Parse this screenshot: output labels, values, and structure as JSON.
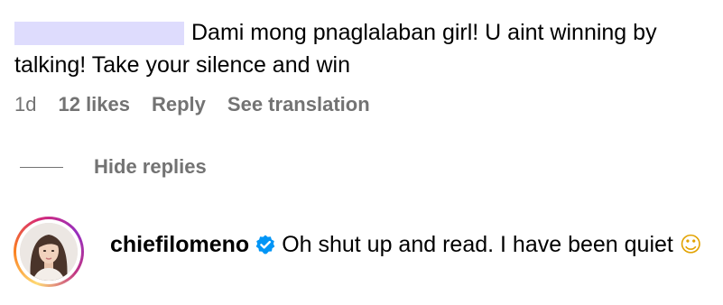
{
  "top_comment": {
    "text_line": "Dami mong pnaglalaban girl! U aint winning by talking! Take your silence and win",
    "time": "1d",
    "likes": "12 likes",
    "reply_label": "Reply",
    "translate_label": "See translation"
  },
  "thread": {
    "hide_replies_label": "Hide replies"
  },
  "reply": {
    "username": "chiefilomeno",
    "text": "Oh shut up and read. I have been quiet",
    "emoji": "☺",
    "verified_color": "#0095f6"
  },
  "colors": {
    "meta_gray": "#737373",
    "redaction": "#dedcfd"
  }
}
